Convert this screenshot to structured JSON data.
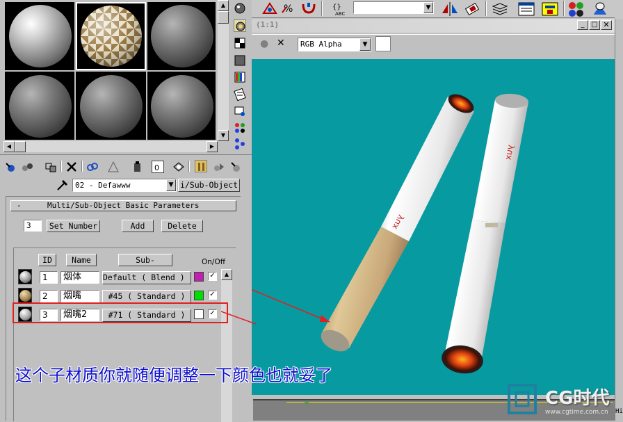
{
  "toolbar": {
    "icons": [
      "snap-angle-icon",
      "percent-snap-icon",
      "spinner-snap-icon",
      "named-selection-icon",
      "mirror-icon",
      "align-icon",
      "layer-icon",
      "curve-editor-icon",
      "schematic-icon",
      "material-editor-icon",
      "render-icon"
    ]
  },
  "material_editor": {
    "sample_slots": [
      "sphere-gray",
      "sphere-checker",
      "sphere-gray",
      "sphere-gray",
      "sphere-gray",
      "sphere-gray"
    ],
    "material_name": "02 - Defawww",
    "material_type": "i/Sub-Object",
    "rollout_title": "Multi/Sub-Object Basic Parameters",
    "count": "3",
    "set_number_label": "Set Number",
    "add_label": "Add",
    "delete_label": "Delete",
    "col_id": "ID",
    "col_name": "Name",
    "col_submaterial": "Sub-Material",
    "col_onoff": "On/Off",
    "rows": [
      {
        "id": "1",
        "name": "烟体",
        "material": "Default  ( Blend )",
        "color": "#c020b0"
      },
      {
        "id": "2",
        "name": "烟嘴",
        "material": "#45   ( Standard )",
        "color": "#00e000"
      },
      {
        "id": "3",
        "name": "烟嘴2",
        "material": "#71   ( Standard )",
        "color": "#ffffff"
      }
    ]
  },
  "render_window": {
    "title": "(1:1)",
    "channel": "RGB Alpha",
    "brand_text_1": "yux",
    "brand_text_2": "yux"
  },
  "annotation": {
    "text": "这个子材质你就随便调整一下颜色也就妥了",
    "color": "#1010d0",
    "highlight_color": "#e02020"
  },
  "watermark": {
    "logo": "CG时代",
    "url": "www.cgtime.com.cn"
  },
  "right_panel": {
    "hide_label": "Hide"
  }
}
